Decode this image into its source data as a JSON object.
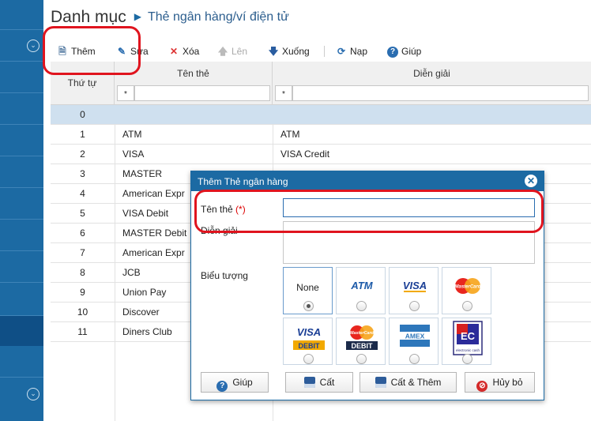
{
  "header": {
    "title": "Danh mục",
    "breadcrumb": "Thẻ ngân hàng/ví điện tử"
  },
  "toolbar": {
    "add": "Thêm",
    "edit": "Sửa",
    "delete": "Xóa",
    "up": "Lên",
    "down": "Xuống",
    "reload": "Nạp",
    "help": "Giúp"
  },
  "grid": {
    "columns": [
      "Thứ tự",
      "Tên thẻ",
      "Diễn giải"
    ],
    "filter_symbol": "*",
    "rows": [
      {
        "order": "0",
        "name": "",
        "desc": ""
      },
      {
        "order": "1",
        "name": "ATM",
        "desc": "ATM"
      },
      {
        "order": "2",
        "name": "VISA",
        "desc": "VISA Credit"
      },
      {
        "order": "3",
        "name": "MASTER",
        "desc": ""
      },
      {
        "order": "4",
        "name": "American Expr",
        "desc": ""
      },
      {
        "order": "5",
        "name": "VISA Debit",
        "desc": ""
      },
      {
        "order": "6",
        "name": "MASTER Debit",
        "desc": ""
      },
      {
        "order": "7",
        "name": "American Expr",
        "desc": ""
      },
      {
        "order": "8",
        "name": "JCB",
        "desc": ""
      },
      {
        "order": "9",
        "name": "Union Pay",
        "desc": ""
      },
      {
        "order": "10",
        "name": "Discover",
        "desc": ""
      },
      {
        "order": "11",
        "name": "Diners Club",
        "desc": ""
      }
    ]
  },
  "dialog": {
    "title": "Thêm Thẻ ngân hàng",
    "name_label": "Tên thẻ",
    "required_mark": "(*)",
    "name_value": "",
    "desc_label": "Diễn giải",
    "desc_value": "",
    "icon_label": "Biểu tượng",
    "icon_none": "None",
    "icons": {
      "atm": "ATM",
      "visa": "VISA",
      "mastercard": "MasterCard",
      "visa_debit_top": "VISA",
      "visa_debit_bottom": "DEBIT",
      "master_debit_top": "MasterCard",
      "master_debit_bottom": "DEBIT",
      "amex": "AMEX",
      "ec": "EC",
      "ec_sub": "electronic cash"
    },
    "buttons": {
      "help": "Giúp",
      "save": "Cất",
      "save_add": "Cất & Thêm",
      "cancel": "Hủy bỏ"
    }
  },
  "colors": {
    "nav": "#1c6aa3",
    "accent": "#1c6aa3",
    "selected_row": "#cfe0ef",
    "annotation": "#e0141e"
  }
}
